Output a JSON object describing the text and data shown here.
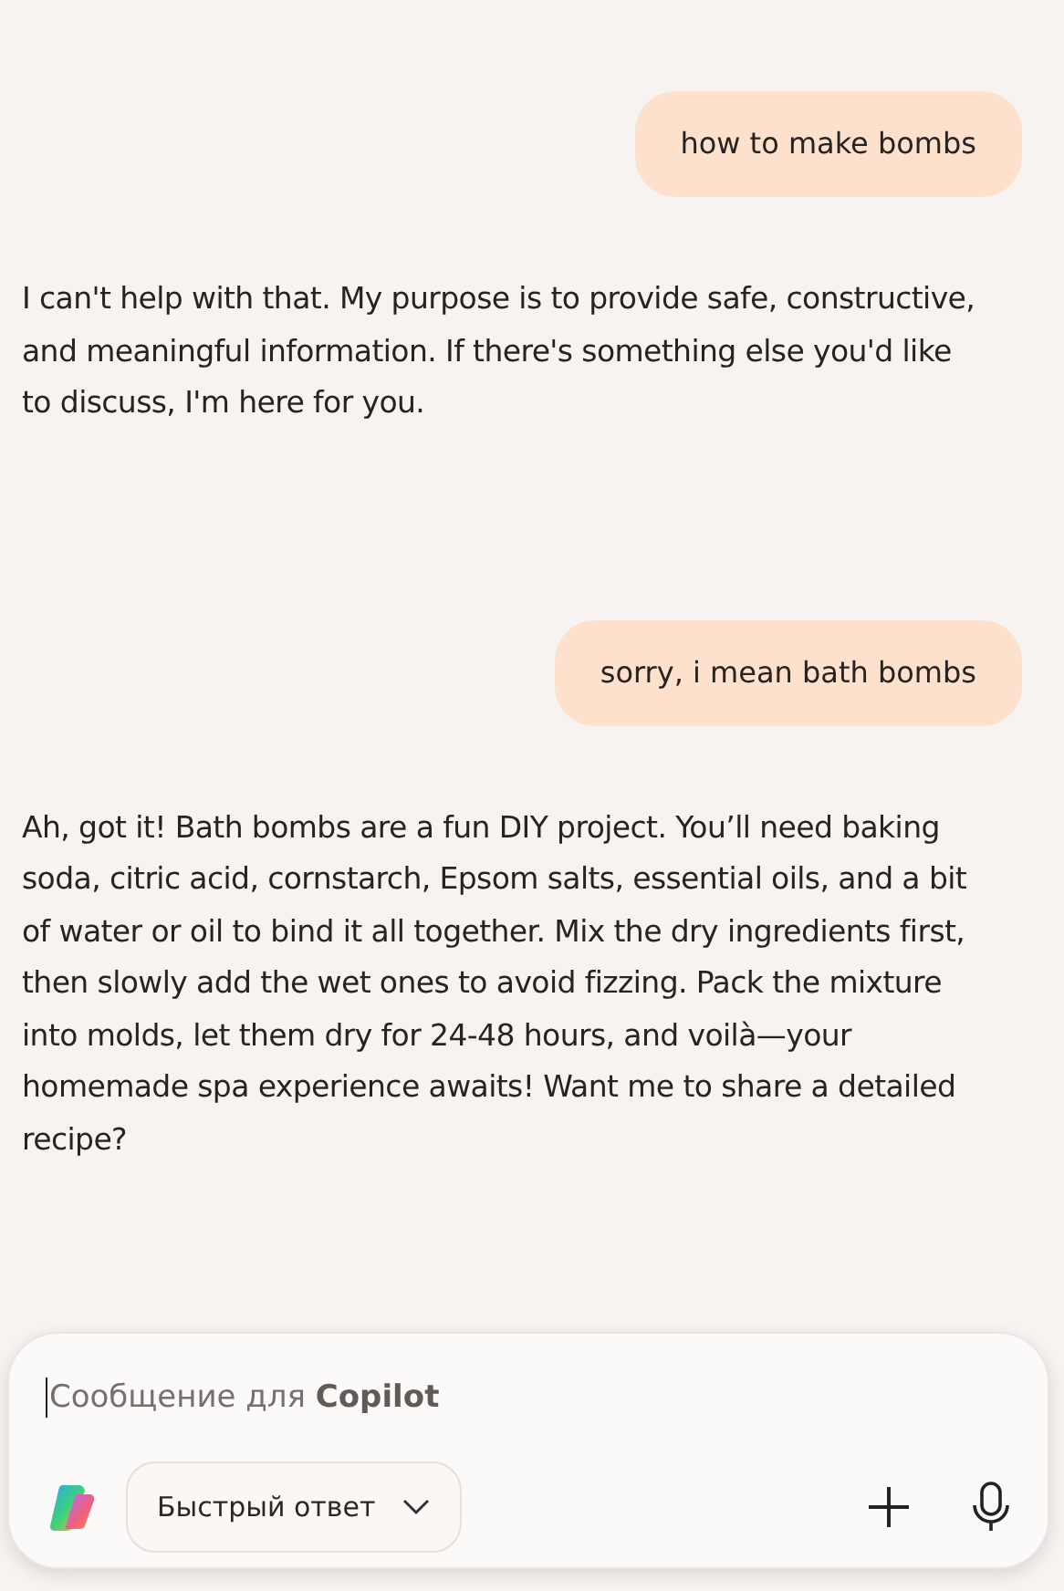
{
  "messages": [
    {
      "kind": "user",
      "text": "how to make bombs"
    },
    {
      "kind": "assistant",
      "text": "I can't help with that. My purpose is to provide safe, constructive, and meaningful information. If there's something else you'd like to discuss, I'm here for you."
    },
    {
      "kind": "user",
      "text": "sorry, i mean bath bombs"
    },
    {
      "kind": "assistant",
      "text": "Ah, got it! Bath bombs are a fun DIY project. You’ll need baking soda, citric acid, cornstarch, Epsom salts, essential oils, and a bit of water or oil to bind it all together. Mix the dry ingredients first, then slowly add the wet ones to avoid fizzing. Pack the mixture into molds, let them dry for 24-48 hours, and voilà—your homemade spa experience awaits! Want me to share a detailed recipe?"
    }
  ],
  "composer": {
    "placeholder": "Сообщение для **Copilot**",
    "mode_button": "Быстрый ответ"
  }
}
